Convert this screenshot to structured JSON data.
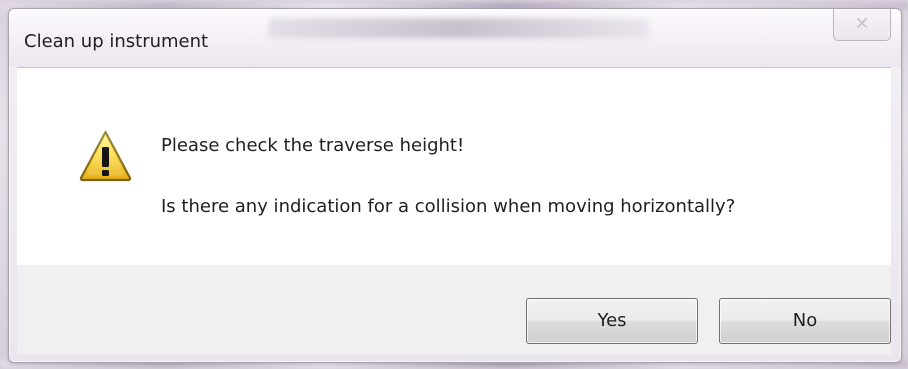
{
  "dialog": {
    "title": "Clean up instrument",
    "close_icon": "close-icon",
    "close_glyph": "✕",
    "message": {
      "line1": "Please check the traverse height!",
      "line2": "Is there any indication for a collision when moving horizontally?"
    },
    "buttons": {
      "yes": "Yes",
      "no": "No"
    },
    "icon": "warning-icon"
  },
  "colors": {
    "background": "#d9d2de",
    "window_border": "#a8a2aa",
    "button_panel": "#f0f0f0",
    "warning_yellow": "#f3c624"
  }
}
